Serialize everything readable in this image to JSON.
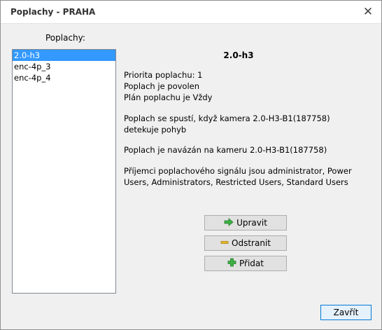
{
  "window": {
    "title": "Poplachy - PRAHA",
    "close_symbol": "✕"
  },
  "list": {
    "label": "Poplachy:",
    "items": [
      {
        "label": "2.0-h3",
        "selected": true
      },
      {
        "label": "enc-4p_3",
        "selected": false
      },
      {
        "label": "enc-4p_4",
        "selected": false
      }
    ]
  },
  "detail": {
    "title": "2.0-h3",
    "priority": "Priorita poplachu: 1",
    "enabled": "Poplach je povolen",
    "schedule": "Plán poplachu je Vždy",
    "trigger": "Poplach se spustí, když kamera 2.0-H3-B1(187758) detekuje pohyb",
    "bound": "Poplach je navázán na kameru 2.0-H3-B1(187758)",
    "recipients": "Příjemci poplachového signálu jsou administrator, Power Users, Administrators, Restricted Users, Standard Users"
  },
  "buttons": {
    "edit": "Upravit",
    "remove": "Odstranit",
    "add": "Přidat",
    "close": "Zavřít"
  },
  "icons": {
    "edit": "arrow-right-green-icon",
    "remove": "minus-yellow-icon",
    "add": "plus-green-icon"
  },
  "colors": {
    "selection": "#3399ff",
    "green_icon": "#3cb043",
    "yellow_icon": "#e8b923",
    "accent_border": "#0078d7"
  }
}
